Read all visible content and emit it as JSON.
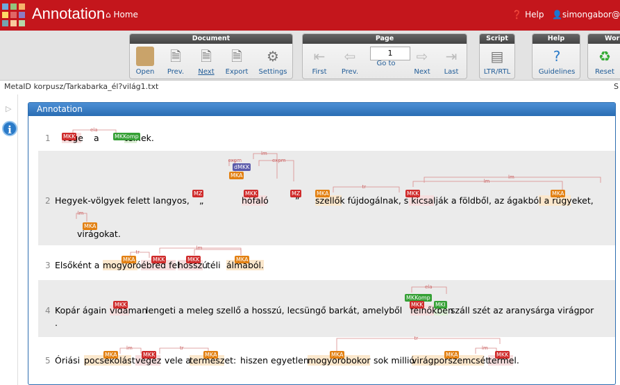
{
  "topbar": {
    "title": "Annotation",
    "home": "Home",
    "help": "Help",
    "user": "simongabor@"
  },
  "toolbar": {
    "document": {
      "title": "Document",
      "buttons": [
        "Open",
        "Prev.",
        "Next",
        "Export",
        "Settings"
      ]
    },
    "page": {
      "title": "Page",
      "buttons": [
        "First",
        "Prev.",
        "Go to",
        "Next",
        "Last"
      ],
      "current": "1"
    },
    "script": {
      "title": "Script",
      "buttons": [
        "LTR/RTL"
      ]
    },
    "help": {
      "title": "Help",
      "buttons": [
        "Guidelines"
      ]
    },
    "work": {
      "title": "Wor",
      "buttons": [
        "Reset"
      ]
    }
  },
  "meta": {
    "path": "MetaID korpusz/Tarkabarka_él?világ1.txt",
    "right": "S"
  },
  "panel": {
    "title": "Annotation"
  },
  "sentences": [
    {
      "n": "1",
      "text": "Vége a télnek."
    },
    {
      "n": "2",
      "text": "Hegyek-völgyek felett langyos, „ hófaló ” szellők fújdogálnak, s kicsalják a földből, az ágakból a rügyeket, virágokat."
    },
    {
      "n": "3",
      "text": "Elsőként a mogyoró ébred fel hosszú téli álmából."
    },
    {
      "n": "4",
      "text": "Kopár ágain vidáman lengeti a meleg szellő a hosszú, lecsüngő barkát, amelyből felhőkben száll szét az aranysárga virágpor ."
    },
    {
      "n": "5",
      "text": "Óriási pocsékolást végez vele a természet: hiszen egyetlen mogyoróbokor sok millió virágporszemcsét termel."
    }
  ],
  "labels": {
    "mkk": "MKK",
    "mka": "MKA",
    "mz": "MZ",
    "mkkomp": "MKKomp",
    "dmkk": "dMKK",
    "mki": "MKI"
  },
  "relations": {
    "ela": "ela",
    "expm": "expm",
    "lm": "lm",
    "tr": "tr"
  },
  "colors": {
    "topbar": "#c4161c",
    "panel": "#2a6db3",
    "mkk": "#cf2b2b",
    "mka": "#e28012",
    "mkkomp": "#35a035",
    "dmkk": "#5a5aaa"
  }
}
